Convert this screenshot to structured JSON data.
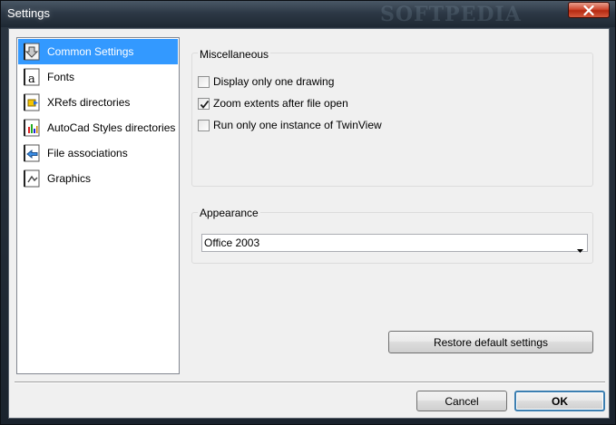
{
  "window": {
    "title": "Settings",
    "watermark": "SOFTPEDIA",
    "close_icon": "close-x-icon"
  },
  "sidebar": {
    "items": [
      {
        "label": "Common Settings",
        "icon": "common-settings-icon",
        "selected": true
      },
      {
        "label": "Fonts",
        "icon": "font-icon",
        "selected": false
      },
      {
        "label": "XRefs directories",
        "icon": "xrefs-icon",
        "selected": false
      },
      {
        "label": "AutoCad Styles directories",
        "icon": "styles-icon",
        "selected": false
      },
      {
        "label": "File associations",
        "icon": "file-associations-icon",
        "selected": false
      },
      {
        "label": "Graphics",
        "icon": "graphics-icon",
        "selected": false
      }
    ]
  },
  "misc": {
    "title": "Miscellaneous",
    "options": [
      {
        "label": "Display only one drawing",
        "checked": false
      },
      {
        "label": "Zoom extents after file open",
        "checked": true
      },
      {
        "label": "Run only one instance of TwinView",
        "checked": false
      }
    ]
  },
  "appearance": {
    "title": "Appearance",
    "selected": "Office 2003"
  },
  "buttons": {
    "restore": "Restore default settings",
    "cancel": "Cancel",
    "ok": "OK"
  },
  "colors": {
    "selection": "#3399ff",
    "close_button": "#c7432a",
    "dialog_bg": "#f0f0f0"
  }
}
